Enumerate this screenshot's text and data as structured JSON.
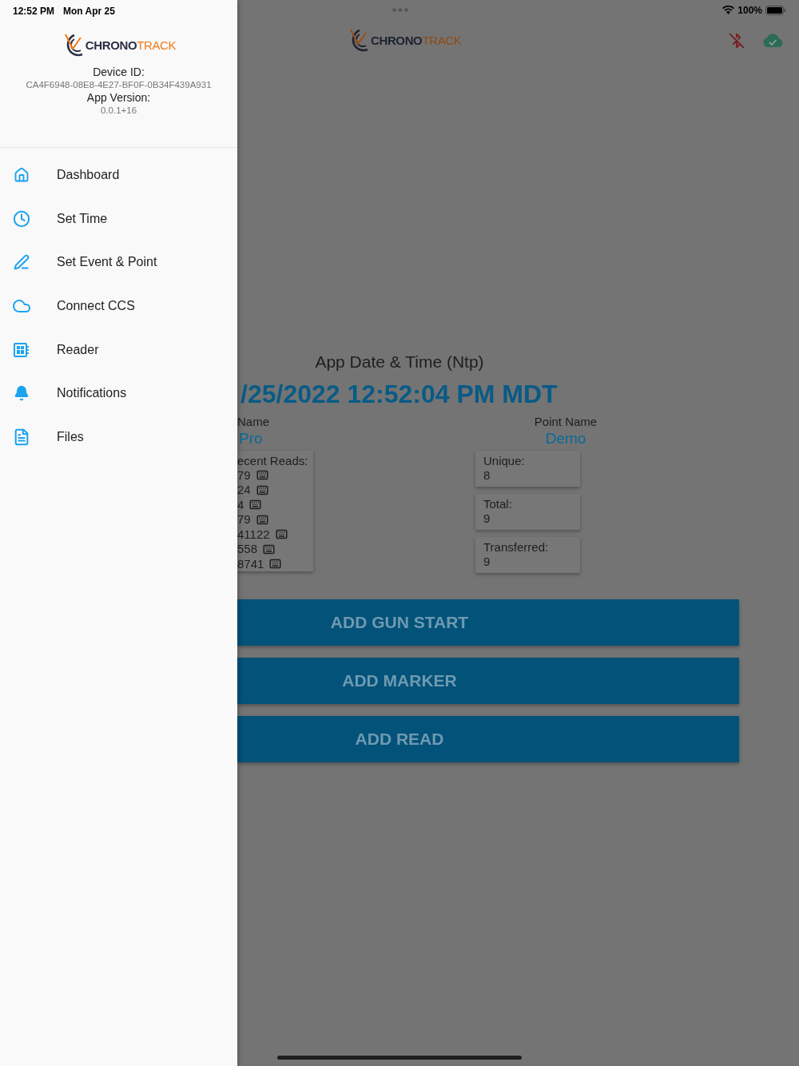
{
  "status_bar": {
    "time": "12:52 PM",
    "date": "Mon Apr 25",
    "battery": "100%"
  },
  "drawer": {
    "logo": {
      "first": "CHRONO",
      "second": "TRACK"
    },
    "device_id_label": "Device ID:",
    "device_id": "CA4F6948-08E8-4E27-BF0F-0B34F439A931",
    "app_version_label": "App Version:",
    "app_version": "0.0.1+16",
    "items": [
      {
        "kind": "home",
        "label": "Dashboard"
      },
      {
        "kind": "clock",
        "label": "Set Time"
      },
      {
        "kind": "pen",
        "label": "Set Event & Point"
      },
      {
        "kind": "cloud",
        "label": "Connect CCS"
      },
      {
        "kind": "reader",
        "label": "Reader"
      },
      {
        "kind": "bell",
        "label": "Notifications"
      },
      {
        "kind": "file",
        "label": "Files"
      }
    ]
  },
  "header": {
    "logo": {
      "first": "CHRONO",
      "second": "TRACK"
    }
  },
  "main": {
    "date_title": "App Date & Time (Ntp)",
    "date_value": "/25/2022 12:52:04 PM MDT",
    "event_label": "Name",
    "event_value": "Pro",
    "point_label": "Point Name",
    "point_value": "Demo",
    "reads_title": "ecent Reads:",
    "reads": [
      "79",
      "24",
      "4",
      "79",
      "41122",
      "558",
      "8741"
    ],
    "stats": [
      {
        "label": "Unique:",
        "value": "8"
      },
      {
        "label": "Total:",
        "value": "9"
      },
      {
        "label": "Transferred:",
        "value": "9"
      }
    ],
    "buttons": [
      "ADD GUN START",
      "ADD MARKER",
      "ADD READ"
    ]
  }
}
